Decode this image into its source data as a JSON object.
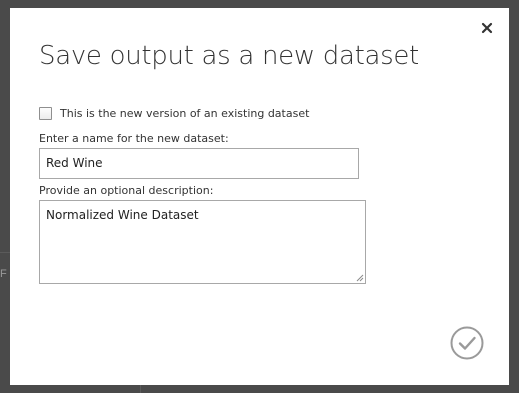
{
  "dialog": {
    "title": "Save output as a new dataset",
    "close_icon": "close-icon",
    "existing_version": {
      "label": "This is the new version of an existing dataset",
      "checked": false
    },
    "name_field": {
      "label": "Enter a name for the new dataset:",
      "value": "Red Wine"
    },
    "description_field": {
      "label": "Provide an optional description:",
      "value": "Normalized Wine Dataset"
    },
    "ok_icon": "checkmark-circle-icon"
  },
  "background": {
    "fragment_text": "F"
  },
  "colors": {
    "overlay": "#4a4a4a",
    "dialog_bg": "#ffffff",
    "text": "#333333",
    "border": "#a8a8a8",
    "ok_icon": "#9a9a9a"
  }
}
